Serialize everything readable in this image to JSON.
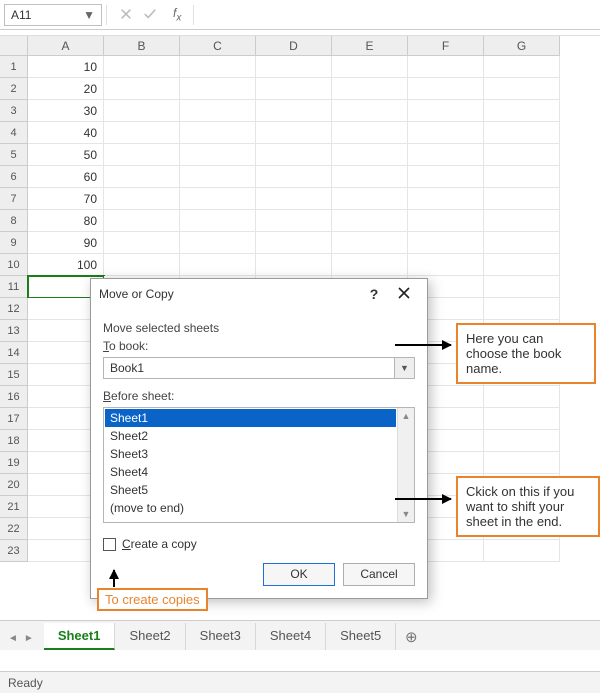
{
  "namebox": "A11",
  "columns": [
    "A",
    "B",
    "C",
    "D",
    "E",
    "F",
    "G"
  ],
  "rows": [
    1,
    2,
    3,
    4,
    5,
    6,
    7,
    8,
    9,
    10,
    11,
    12,
    13,
    14,
    15,
    16,
    17,
    18,
    19,
    20,
    21,
    22,
    23
  ],
  "cells": {
    "A1": "10",
    "A2": "20",
    "A3": "30",
    "A4": "40",
    "A5": "50",
    "A6": "60",
    "A7": "70",
    "A8": "80",
    "A9": "90",
    "A10": "100"
  },
  "active_cell": "A11",
  "dialog": {
    "title": "Move or Copy",
    "label_move": "Move selected sheets",
    "label_tobook": "To book:",
    "book_value": "Book1",
    "label_before": "Before sheet:",
    "sheets": [
      "Sheet1",
      "Sheet2",
      "Sheet3",
      "Sheet4",
      "Sheet5",
      "(move to end)"
    ],
    "selected_index": 0,
    "checkbox_label": "Create a copy",
    "ok": "OK",
    "cancel": "Cancel"
  },
  "annotations": {
    "a1": "Here you can choose the book name.",
    "a2": "Ckick on this if you want to shift your sheet in the end.",
    "a3": "To create copies"
  },
  "tabs": [
    "Sheet1",
    "Sheet2",
    "Sheet3",
    "Sheet4",
    "Sheet5"
  ],
  "active_tab": 0,
  "status": "Ready"
}
